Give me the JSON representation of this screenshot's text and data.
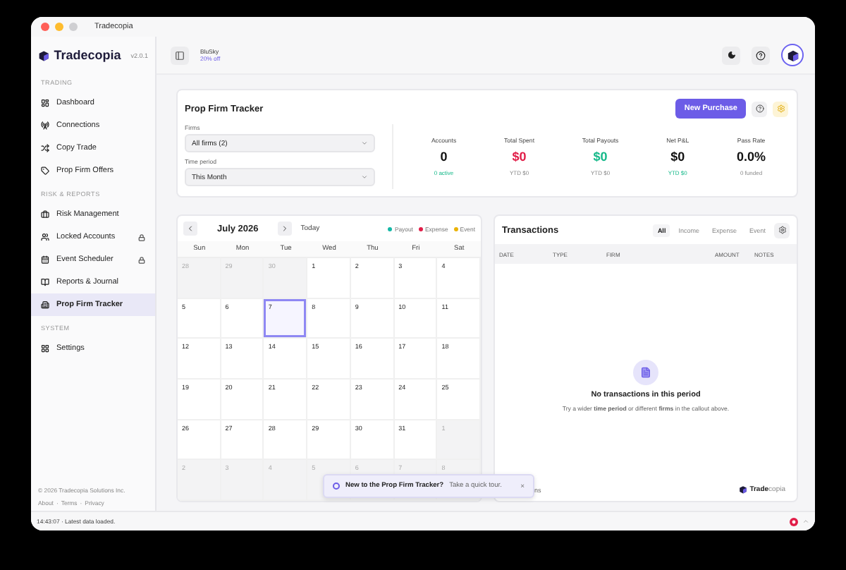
{
  "window": {
    "title": "Tradecopia"
  },
  "sidebar": {
    "brand": "Tradecopia",
    "version": "v2.0.1",
    "sections": [
      {
        "heading": "TRADING",
        "items": [
          {
            "label": "Dashboard",
            "locked": false,
            "selected": false
          },
          {
            "label": "Connections",
            "locked": false,
            "selected": false
          },
          {
            "label": "Copy Trade",
            "locked": false,
            "selected": false
          },
          {
            "label": "Prop Firm Offers",
            "locked": false,
            "selected": false
          }
        ]
      },
      {
        "heading": "RISK & REPORTS",
        "items": [
          {
            "label": "Risk Management",
            "locked": false,
            "selected": false
          },
          {
            "label": "Locked Accounts",
            "locked": true,
            "selected": false
          },
          {
            "label": "Event Scheduler",
            "locked": true,
            "selected": false
          },
          {
            "label": "Reports & Journal",
            "locked": false,
            "selected": false
          },
          {
            "label": "Prop Firm Tracker",
            "locked": false,
            "selected": true
          }
        ]
      },
      {
        "heading": "SYSTEM",
        "items": [
          {
            "label": "Settings",
            "locked": false,
            "selected": false
          }
        ]
      }
    ],
    "copyright": "© 2026 Tradecopia Solutions Inc.",
    "links": [
      "About",
      "Terms",
      "Privacy"
    ],
    "link_separator": "·"
  },
  "topbar": {
    "promo_name": "BluSky",
    "promo_offer": "20% off"
  },
  "tracker": {
    "title": "Prop Firm Tracker",
    "primary_button": "New Purchase",
    "filters": [
      {
        "label": "Firms",
        "value": "All firms (2)"
      },
      {
        "label": "Time period",
        "value": "This Month"
      }
    ],
    "stats": [
      {
        "label": "Accounts",
        "value": "0",
        "color": "#111111",
        "sub": "0 active",
        "sub_highlight": true
      },
      {
        "label": "Total Spent",
        "value": "$0",
        "color": "#e11d48",
        "sub": "YTD $0",
        "sub_highlight": false
      },
      {
        "label": "Total Payouts",
        "value": "$0",
        "color": "#16b98a",
        "sub": "YTD $0",
        "sub_highlight": false
      },
      {
        "label": "Net P&L",
        "value": "$0",
        "color": "#111111",
        "sub": "YTD $0",
        "sub_highlight": true
      },
      {
        "label": "Pass Rate",
        "value": "0.0%",
        "color": "#111111",
        "sub": "0 funded",
        "sub_highlight": false
      }
    ]
  },
  "calendar": {
    "month": "July 2026",
    "today_button": "Today",
    "legend": [
      {
        "label": "Payout",
        "color": "#14b8a6"
      },
      {
        "label": "Expense",
        "color": "#e11d48"
      },
      {
        "label": "Event",
        "color": "#eab308"
      }
    ],
    "weekdays": [
      "Sun",
      "Mon",
      "Tue",
      "Wed",
      "Thu",
      "Fri",
      "Sat"
    ],
    "weeks": [
      [
        {
          "day": "28",
          "outside": true,
          "selected": false
        },
        {
          "day": "29",
          "outside": true,
          "selected": false
        },
        {
          "day": "30",
          "outside": true,
          "selected": false
        },
        {
          "day": "1",
          "outside": false,
          "selected": false
        },
        {
          "day": "2",
          "outside": false,
          "selected": false
        },
        {
          "day": "3",
          "outside": false,
          "selected": false
        },
        {
          "day": "4",
          "outside": false,
          "selected": false
        }
      ],
      [
        {
          "day": "5",
          "outside": false,
          "selected": false
        },
        {
          "day": "6",
          "outside": false,
          "selected": false
        },
        {
          "day": "7",
          "outside": false,
          "selected": true
        },
        {
          "day": "8",
          "outside": false,
          "selected": false
        },
        {
          "day": "9",
          "outside": false,
          "selected": false
        },
        {
          "day": "10",
          "outside": false,
          "selected": false
        },
        {
          "day": "11",
          "outside": false,
          "selected": false
        }
      ],
      [
        {
          "day": "12",
          "outside": false,
          "selected": false
        },
        {
          "day": "13",
          "outside": false,
          "selected": false
        },
        {
          "day": "14",
          "outside": false,
          "selected": false
        },
        {
          "day": "15",
          "outside": false,
          "selected": false
        },
        {
          "day": "16",
          "outside": false,
          "selected": false
        },
        {
          "day": "17",
          "outside": false,
          "selected": false
        },
        {
          "day": "18",
          "outside": false,
          "selected": false
        }
      ],
      [
        {
          "day": "19",
          "outside": false,
          "selected": false
        },
        {
          "day": "20",
          "outside": false,
          "selected": false
        },
        {
          "day": "21",
          "outside": false,
          "selected": false
        },
        {
          "day": "22",
          "outside": false,
          "selected": false
        },
        {
          "day": "23",
          "outside": false,
          "selected": false
        },
        {
          "day": "24",
          "outside": false,
          "selected": false
        },
        {
          "day": "25",
          "outside": false,
          "selected": false
        }
      ],
      [
        {
          "day": "26",
          "outside": false,
          "selected": false
        },
        {
          "day": "27",
          "outside": false,
          "selected": false
        },
        {
          "day": "28",
          "outside": false,
          "selected": false
        },
        {
          "day": "29",
          "outside": false,
          "selected": false
        },
        {
          "day": "30",
          "outside": false,
          "selected": false
        },
        {
          "day": "31",
          "outside": false,
          "selected": false
        },
        {
          "day": "1",
          "outside": true,
          "selected": false
        }
      ],
      [
        {
          "day": "2",
          "outside": true,
          "selected": false
        },
        {
          "day": "3",
          "outside": true,
          "selected": false
        },
        {
          "day": "4",
          "outside": true,
          "selected": false
        },
        {
          "day": "5",
          "outside": true,
          "selected": false
        },
        {
          "day": "6",
          "outside": true,
          "selected": false
        },
        {
          "day": "7",
          "outside": true,
          "selected": false
        },
        {
          "day": "8",
          "outside": true,
          "selected": false
        }
      ]
    ]
  },
  "transactions": {
    "title": "Transactions",
    "filters": [
      {
        "label": "All",
        "selected": true
      },
      {
        "label": "Income",
        "selected": false
      },
      {
        "label": "Expense",
        "selected": false
      },
      {
        "label": "Event",
        "selected": false
      }
    ],
    "columns": [
      "DATE",
      "TYPE",
      "FIRM",
      "AMOUNT",
      "NOTES"
    ],
    "empty_title": "No transactions in this period",
    "empty_hint": "Try a wider **time period** or different **firms** in the callout above.",
    "footer_note": "ns",
    "footer_brand_a": "Trade",
    "footer_brand_b": "copia"
  },
  "toast": {
    "title": "New to the Prop Firm Tracker?",
    "text": "Take a quick tour.",
    "close": "×"
  },
  "status_bar": {
    "text": "14:43:07 · Latest data loaded."
  }
}
